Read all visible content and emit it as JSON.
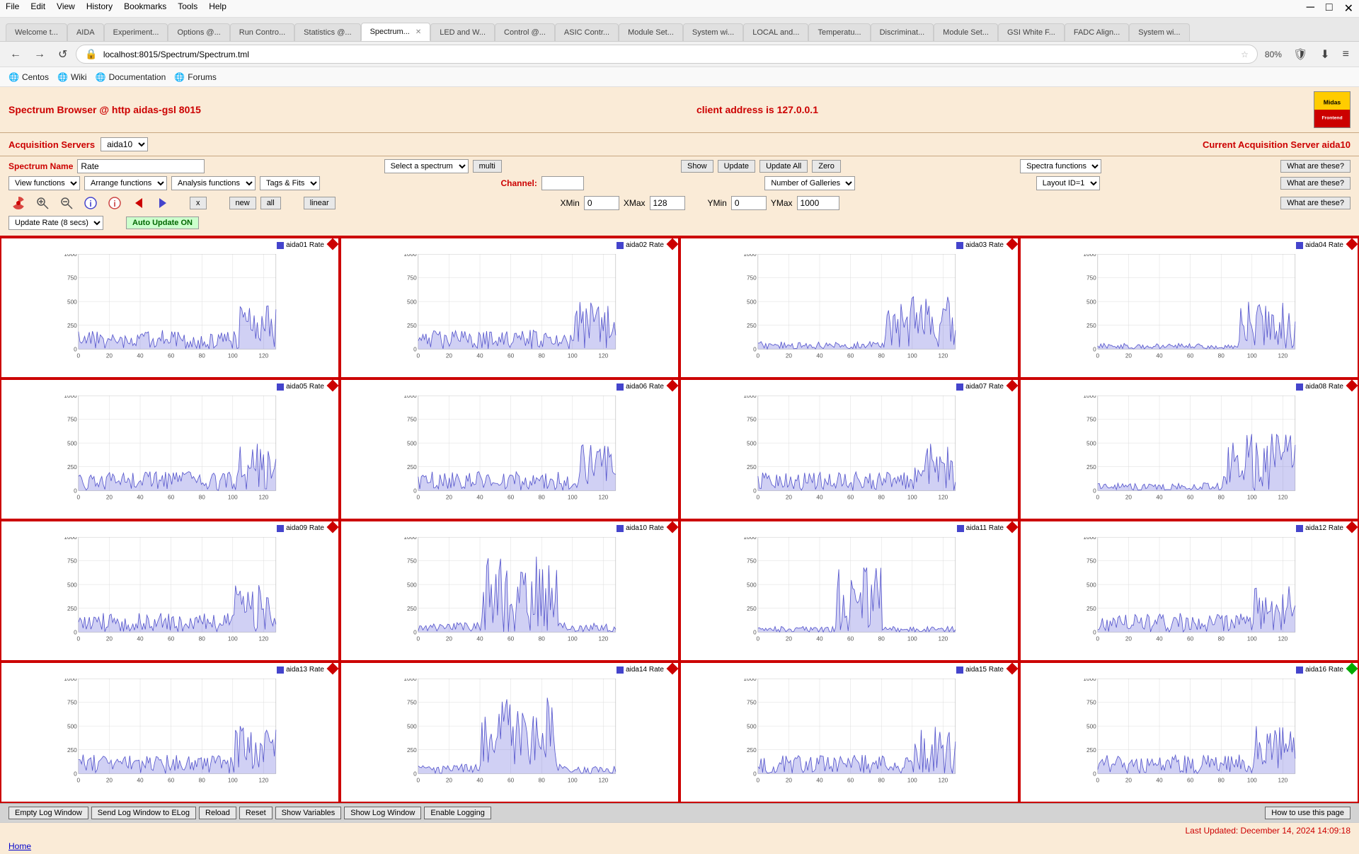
{
  "browser": {
    "menu_items": [
      "File",
      "Edit",
      "View",
      "History",
      "Bookmarks",
      "Tools",
      "Help"
    ],
    "url": "localhost:8015/Spectrum/Spectrum.tml",
    "zoom": "80%",
    "tabs": [
      {
        "label": "Welcome t...",
        "active": false
      },
      {
        "label": "AIDA",
        "active": false
      },
      {
        "label": "Experiment...",
        "active": false
      },
      {
        "label": "Options @...",
        "active": false
      },
      {
        "label": "Run Contro...",
        "active": false
      },
      {
        "label": "Statistics @...",
        "active": false
      },
      {
        "label": "Spectrum...",
        "active": true
      },
      {
        "label": "LED and W...",
        "active": false
      },
      {
        "label": "Control @...",
        "active": false
      },
      {
        "label": "ASIC Contr...",
        "active": false
      },
      {
        "label": "Module Set...",
        "active": false
      },
      {
        "label": "System wi...",
        "active": false
      },
      {
        "label": "LOCAL and...",
        "active": false
      },
      {
        "label": "Temperatu...",
        "active": false
      },
      {
        "label": "Discriminat...",
        "active": false
      },
      {
        "label": "Module Set...",
        "active": false
      },
      {
        "label": "GSI White F...",
        "active": false
      },
      {
        "label": "FADC Align...",
        "active": false
      },
      {
        "label": "System wi...",
        "active": false
      }
    ],
    "bookmarks": [
      {
        "label": "Centos"
      },
      {
        "label": "Wiki"
      },
      {
        "label": "Documentation"
      },
      {
        "label": "Forums"
      }
    ]
  },
  "page": {
    "title": "Spectrum Browser @ http aidas-gsl 8015",
    "client_address": "client address is 127.0.0.1",
    "acq_servers_label": "Acquisition Servers",
    "acq_server_value": "aida10",
    "current_server": "Current Acquisition Server aida10"
  },
  "controls": {
    "spectrum_name_label": "Spectrum Name",
    "spectrum_name_value": "Rate",
    "select_spectrum_label": "Select a spectrum",
    "multi_label": "multi",
    "show_label": "Show",
    "update_label": "Update",
    "update_all_label": "Update All",
    "zero_label": "Zero",
    "spectra_functions_label": "Spectra functions",
    "what_are_these_1": "What are these?",
    "view_functions_label": "View functions",
    "arrange_functions_label": "Arrange functions",
    "analysis_functions_label": "Analysis functions",
    "tags_fits_label": "Tags & Fits",
    "channel_label": "Channel:",
    "channel_value": "",
    "number_of_galleries_label": "Number of Galleries",
    "layout_id_label": "Layout ID=1",
    "what_are_these_2": "What are these?",
    "xmin_label": "XMin",
    "xmin_value": "0",
    "xmax_label": "XMax",
    "xmax_value": "128",
    "ymin_label": "YMin",
    "ymin_value": "0",
    "ymax_label": "YMax",
    "ymax_value": "1000",
    "what_are_these_3": "What are these?",
    "x_btn": "x",
    "new_btn": "new",
    "all_btn": "all",
    "linear_btn": "linear",
    "update_rate_label": "Update Rate (8 secs)",
    "auto_update_label": "Auto Update ON"
  },
  "charts": [
    {
      "id": 1,
      "label": "aida01 Rate",
      "diamond_color": "red"
    },
    {
      "id": 2,
      "label": "aida02 Rate",
      "diamond_color": "red"
    },
    {
      "id": 3,
      "label": "aida03 Rate",
      "diamond_color": "red"
    },
    {
      "id": 4,
      "label": "aida04 Rate",
      "diamond_color": "red"
    },
    {
      "id": 5,
      "label": "aida05 Rate",
      "diamond_color": "red"
    },
    {
      "id": 6,
      "label": "aida06 Rate",
      "diamond_color": "red"
    },
    {
      "id": 7,
      "label": "aida07 Rate",
      "diamond_color": "red"
    },
    {
      "id": 8,
      "label": "aida08 Rate",
      "diamond_color": "red"
    },
    {
      "id": 9,
      "label": "aida09 Rate",
      "diamond_color": "red"
    },
    {
      "id": 10,
      "label": "aida10 Rate",
      "diamond_color": "red"
    },
    {
      "id": 11,
      "label": "aida11 Rate",
      "diamond_color": "red"
    },
    {
      "id": 12,
      "label": "aida12 Rate",
      "diamond_color": "red"
    },
    {
      "id": 13,
      "label": "aida13 Rate",
      "diamond_color": "red"
    },
    {
      "id": 14,
      "label": "aida14 Rate",
      "diamond_color": "red"
    },
    {
      "id": 15,
      "label": "aida15 Rate",
      "diamond_color": "red"
    },
    {
      "id": 16,
      "label": "aida16 Rate",
      "diamond_color": "green"
    }
  ],
  "bottom": {
    "empty_log": "Empty Log Window",
    "send_log": "Send Log Window to ELog",
    "reload": "Reload",
    "reset": "Reset",
    "show_variables": "Show Variables",
    "show_log_window": "Show Log Window",
    "enable_logging": "Enable Logging",
    "how_to": "How to use this page"
  },
  "footer": {
    "last_updated": "Last Updated: December 14, 2024 14:09:18",
    "home": "Home"
  },
  "icons": {
    "back": "←",
    "forward": "→",
    "reload": "↺",
    "search": "🔍",
    "star": "☆",
    "menu": "≡",
    "close": "✕",
    "globe": "🌐",
    "shield": "🛡",
    "download": "⬇"
  }
}
